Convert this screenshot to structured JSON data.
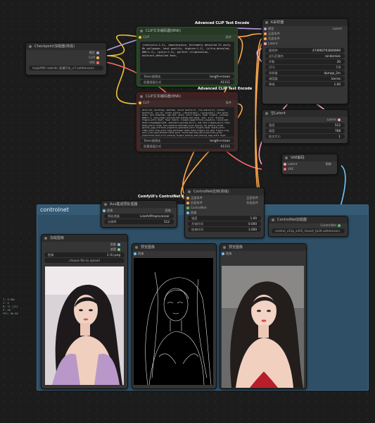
{
  "checkpoint": {
    "title": "Checkpoint加载器(简易)",
    "outputs": [
      "模型",
      "CLIP",
      "VAE"
    ],
    "ckpt_value": "majicMIX realistic 麦橘写实_v7.safetensors"
  },
  "clip_pos": {
    "header": "Advanced CLIP Text Encode",
    "title": "CLIP文本编码器(BNK)",
    "input": "CLIP",
    "output": "条件",
    "text": "(realistic:1.3), (masterpiece, Extremely detailed CG unity 8k wallpaper, best quality, highres:1.2), (ultra_detailed, UHD:1.2), (pixiv:1.3), perfect illumination, distinct,detailed face,",
    "token_label": "Token规格化",
    "token_value": "length+mean",
    "weight_label": "权重插值方式",
    "weight_value": "A1111"
  },
  "clip_neg": {
    "header": "Advanced CLIP Text Encode",
    "title": "CLIP文本编码器(BNK)",
    "input": "CLIP",
    "output": "条件",
    "text": "white hat, paintings, sketches, (worst quality:2), (low quality:2), (normal quality:2), low res, normal quality, ((monochrome)), ((grayscale)), skin spots, acnes, skin blemishes, age spot, glans, extra fingers, fewer fingers, (ulzzang-6500:1.1) ,bad_prompt_version2,bad anatomy,bad hands, text, error, missing fingers,extra digit, fewer digits, cropped,jpegartifacts,signature, lowres,bad-hands-5,EasyNegativeV2, watermark,username,blurry, bad feet,cropped,poorly drawn hands,poorly drawn face,mutation,deformed,worst quality,low quality,normal quality,jpeg artifacts,signature,watermark,extra fingers,fewer digits,extra limbs,extra arms,extra legs,malformed limbs,fused fingers,too many fingers,long neck,cross-eyed,mutated hands,polar lowres,bad body,bad proportions,gross proportions,text,error,missing fingers,missing arms,missing legs,extra digit, extra arms, extra leg, extra foot, (((nsfw)))",
    "token_label": "Token规格化",
    "token_value": "length+mean",
    "weight_label": "权重插值方式",
    "weight_value": "A1111"
  },
  "ksampler": {
    "title": "K采样器",
    "inputs": [
      "模型",
      "正面条件",
      "负面条件",
      "Latent"
    ],
    "output": "Latent",
    "fields": [
      {
        "label": "随机种",
        "value": "474960793606999"
      },
      {
        "label": "运行后操作",
        "value": "randomize"
      },
      {
        "label": "步数",
        "value": "30"
      },
      {
        "label": "CFG",
        "value": "7.0"
      },
      {
        "label": "采样器",
        "value": "dpmpp_2m"
      },
      {
        "label": "调度器",
        "value": "karras"
      },
      {
        "label": "降噪",
        "value": "1.00"
      }
    ]
  },
  "latent": {
    "title": "空Latent",
    "output": "Latent",
    "fields": [
      {
        "label": "宽度",
        "value": "512"
      },
      {
        "label": "高度",
        "value": "768"
      },
      {
        "label": "批次大小",
        "value": "1"
      }
    ]
  },
  "vae_decode": {
    "title": "VAE解码",
    "inputs": [
      "Latent",
      "VAE"
    ],
    "output": "图像"
  },
  "group": {
    "title": "controlnet"
  },
  "aio": {
    "header": "ComfyUI's ControlNet Au...",
    "title": "Aux集成预处理器",
    "input": "图像",
    "output": "图像",
    "fields": [
      {
        "label": "预处理器",
        "value": "LineArtPreprocessor"
      },
      {
        "label": "分辨率",
        "value": "512"
      }
    ]
  },
  "cn_apply": {
    "title": "ControlNet应用(高级)",
    "inputs": [
      "正面条件",
      "负面条件",
      "ControlNet",
      "图像"
    ],
    "outputs": [
      "正面条件",
      "负面条件"
    ],
    "fields": [
      {
        "label": "强度",
        "value": "1.00"
      },
      {
        "label": "开始时间",
        "value": "0.000"
      },
      {
        "label": "结束时间",
        "value": "1.000"
      }
    ]
  },
  "cn_loader": {
    "title": "ControlNet加载器",
    "output": "ControlNet",
    "value": "control_v11p_sd15_lineart_fp16.safetensors"
  },
  "load_image": {
    "title": "加载图像",
    "outputs": [
      "图像",
      "遮罩"
    ],
    "image_label": "图像",
    "image_value": "1 (1).png",
    "upload_label": "choose file to upload"
  },
  "preview1": {
    "title": "预览图像",
    "input": "图像"
  },
  "preview2": {
    "title": "预览图像",
    "input": "图像"
  },
  "stats": [
    "T: 0.00s",
    "I: 0",
    "N: 11 [11]",
    "V: 40",
    "FPS: 60.00"
  ]
}
